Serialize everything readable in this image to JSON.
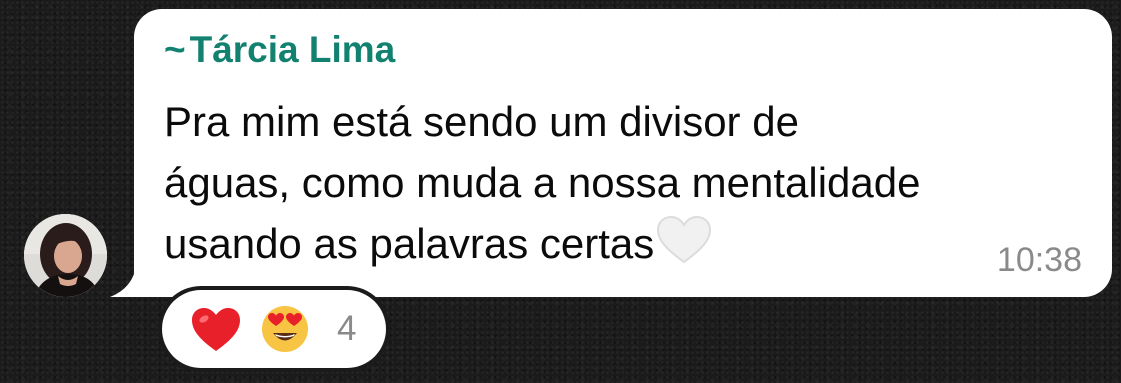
{
  "chat": {
    "sender": {
      "prefix": "~",
      "name": "Tárcia Lima",
      "name_color": "#12816f"
    },
    "message": {
      "lines": [
        "Pra mim está sendo um divisor de",
        "águas, como muda a nossa mentalidade",
        "usando as palavras certas"
      ],
      "trailing_emoji": "white-heart-icon",
      "time": "10:38"
    },
    "reactions": {
      "emojis": [
        "red-heart-icon",
        "heart-eyes-face-icon"
      ],
      "count": "4"
    },
    "avatar": "avatar"
  }
}
